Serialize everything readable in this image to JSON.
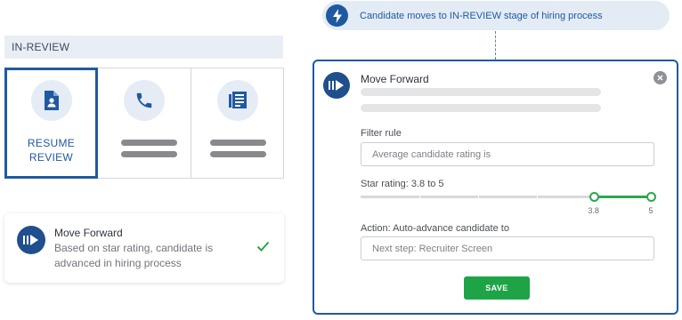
{
  "left": {
    "stage_header": "IN-REVIEW",
    "cards": [
      {
        "icon": "document-person-icon",
        "label_line1": "RESUME",
        "label_line2": "REVIEW",
        "selected": true
      },
      {
        "icon": "phone-icon",
        "selected": false
      },
      {
        "icon": "newspaper-icon",
        "selected": false
      }
    ],
    "move_forward_card": {
      "icon": "move-forward-icon",
      "title": "Move Forward",
      "description": "Based on star rating, candidate is advanced in hiring process",
      "status_icon": "checkmark-icon"
    }
  },
  "right": {
    "trigger": {
      "icon": "lightning-bolt-icon",
      "text": "Candidate moves to IN-REVIEW stage of hiring process"
    },
    "panel": {
      "title": "Move Forward",
      "filter_rule_label": "Filter rule",
      "filter_rule_placeholder": "Average candidate rating is",
      "star_rating_label": "Star rating: 3.8 to 5",
      "slider": {
        "min_label": "3.8",
        "max_label": "5",
        "range_start_fraction": 0.8,
        "range_end_fraction": 1.0
      },
      "action_label": "Action: Auto-advance candidate to",
      "action_placeholder": "Next step: Recruiter Screen",
      "save_label": "SAVE"
    }
  },
  "colors": {
    "primary_blue": "#1f5aa0",
    "badge_navy": "#1f4f8c",
    "success_green": "#2aa84a",
    "save_green": "#1ea446"
  }
}
